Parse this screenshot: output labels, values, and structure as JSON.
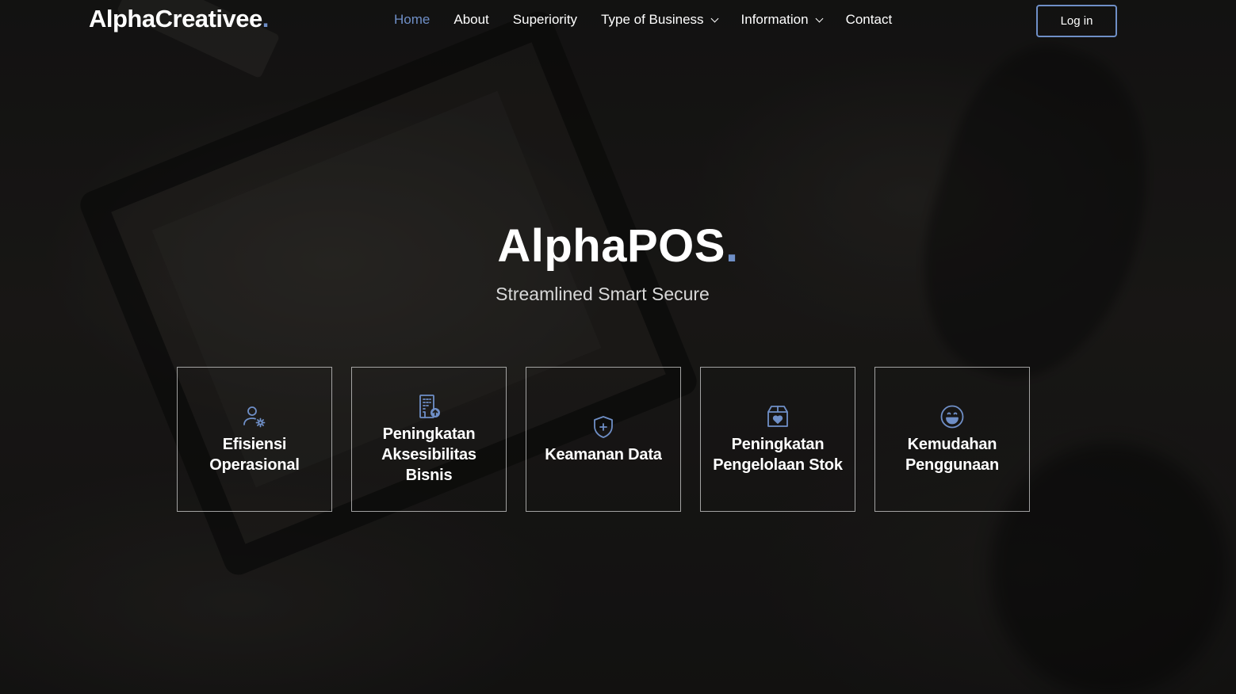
{
  "brand": {
    "name": "AlphaCreativee",
    "dot": ".",
    "accent_color": "#6f8fc7"
  },
  "nav": {
    "items": [
      {
        "label": "Home",
        "active": true,
        "dropdown": false
      },
      {
        "label": "About",
        "active": false,
        "dropdown": false
      },
      {
        "label": "Superiority",
        "active": false,
        "dropdown": false
      },
      {
        "label": "Type of Business",
        "active": false,
        "dropdown": true
      },
      {
        "label": "Information",
        "active": false,
        "dropdown": true
      },
      {
        "label": "Contact",
        "active": false,
        "dropdown": false
      }
    ],
    "login_label": "Log in"
  },
  "hero": {
    "title": "AlphaPOS",
    "title_dot": ".",
    "subtitle": "Streamlined Smart Secure"
  },
  "features": [
    {
      "label": "Efisiensi Operasional",
      "icon": "user-gear-icon"
    },
    {
      "label": "Peningkatan Aksesibilitas Bisnis",
      "icon": "building-upload-icon"
    },
    {
      "label": "Keamanan Data",
      "icon": "shield-plus-icon"
    },
    {
      "label": "Peningkatan Pengelolaan Stok",
      "icon": "box-heart-icon"
    },
    {
      "label": "Kemudahan Penggunaan",
      "icon": "smile-icon"
    }
  ]
}
